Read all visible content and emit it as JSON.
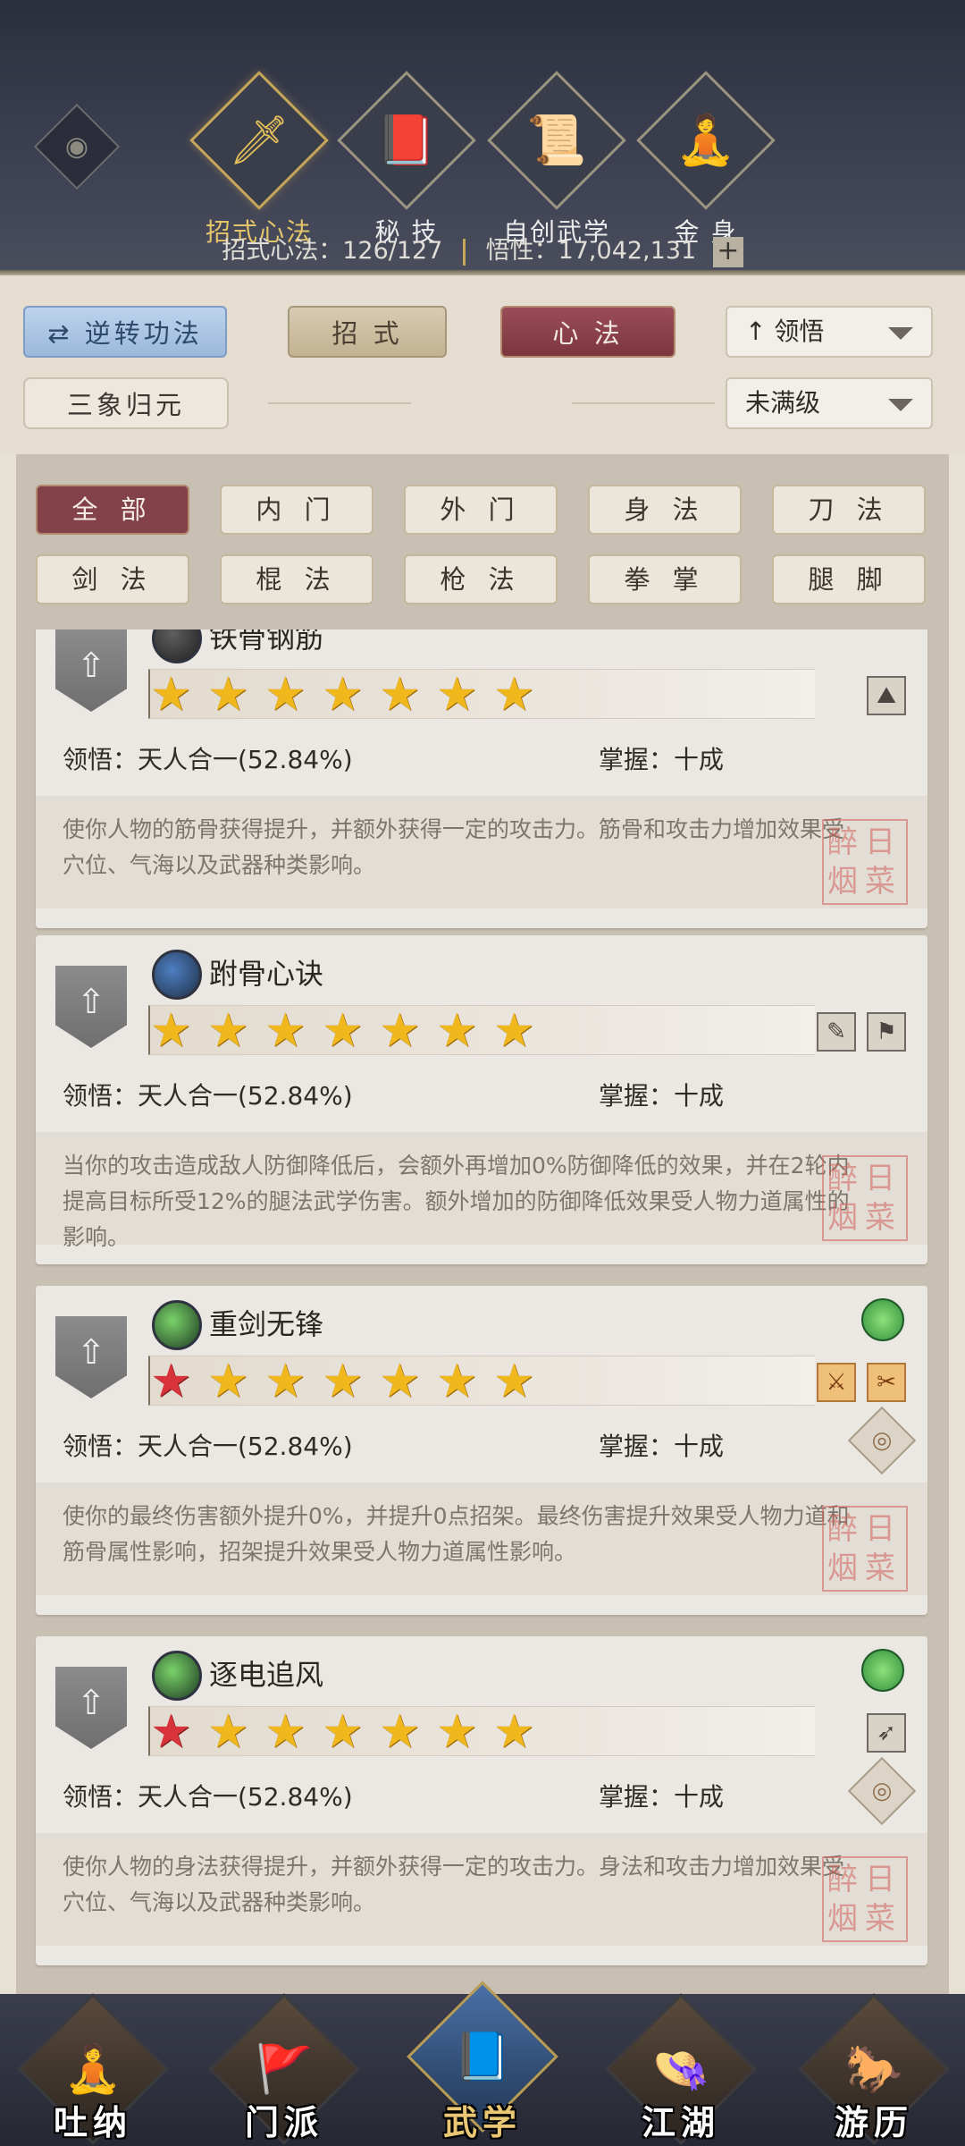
{
  "top_tabs": [
    {
      "label": "招式心法",
      "icon": "sword-icon",
      "active": true
    },
    {
      "label": "秘 技",
      "icon": "book-icon",
      "active": false
    },
    {
      "label": "自创武学",
      "icon": "scroll-icon",
      "active": false
    },
    {
      "label": "金 身",
      "icon": "meditation-icon",
      "active": false
    }
  ],
  "stats": {
    "moves_label": "招式心法：",
    "moves_value": "126/127",
    "wisdom_label": "悟性：",
    "wisdom_value": "17,042,131",
    "plus": "+"
  },
  "controls": {
    "reverse": "逆转功法",
    "moves": "招 式",
    "mind": "心 法",
    "sort": "领悟",
    "unify": "三象归元",
    "level_filter": "未满级"
  },
  "filters": [
    "全 部",
    "内 门",
    "外 门",
    "身 法",
    "刀 法",
    "剑 法",
    "棍 法",
    "枪 法",
    "拳 掌",
    "腿 脚"
  ],
  "cards": [
    {
      "name": "铁骨钢筋",
      "stars": 7,
      "red_star": false,
      "comprehension": "领悟：天人合一(52.84%)",
      "mastery": "掌握：十成",
      "desc": "使你人物的筋骨获得提升，并额外获得一定的攻击力。筋骨和攻击力增加效果受穴位、气海以及武器种类影响。",
      "seal": "醉日 烟菜"
    },
    {
      "name": "跗骨心诀",
      "stars": 7,
      "red_star": false,
      "comprehension": "领悟：天人合一(52.84%)",
      "mastery": "掌握：十成",
      "desc": "当你的攻击造成敌人防御降低后，会额外再增加0%防御降低的效果，并在2轮内提高目标所受12%的腿法武学伤害。额外增加的防御降低效果受人物力道属性的影响。",
      "seal": "醉日 烟菜"
    },
    {
      "name": "重剑无锋",
      "stars": 7,
      "red_star": true,
      "comprehension": "领悟：天人合一(52.84%)",
      "mastery": "掌握：十成",
      "desc": "使你的最终伤害额外提升0%，并提升0点招架。最终伤害提升效果受人物力道和筋骨属性影响，招架提升效果受人物力道属性影响。",
      "seal": "醉日 烟菜"
    },
    {
      "name": "逐电追风",
      "stars": 7,
      "red_star": true,
      "comprehension": "领悟：天人合一(52.84%)",
      "mastery": "掌握：十成",
      "desc": "使你人物的身法获得提升，并额外获得一定的攻击力。身法和攻击力增加效果受穴位、气海以及武器种类影响。",
      "seal": "醉日 烟菜"
    }
  ],
  "bottom_nav": [
    {
      "label": "吐纳",
      "icon": "monk-icon",
      "active": false
    },
    {
      "label": "门派",
      "icon": "flags-icon",
      "active": false
    },
    {
      "label": "武学",
      "icon": "manual-icon",
      "active": true
    },
    {
      "label": "江湖",
      "icon": "straw-hat-icon",
      "active": false
    },
    {
      "label": "游历",
      "icon": "horse-icon",
      "active": false
    }
  ]
}
